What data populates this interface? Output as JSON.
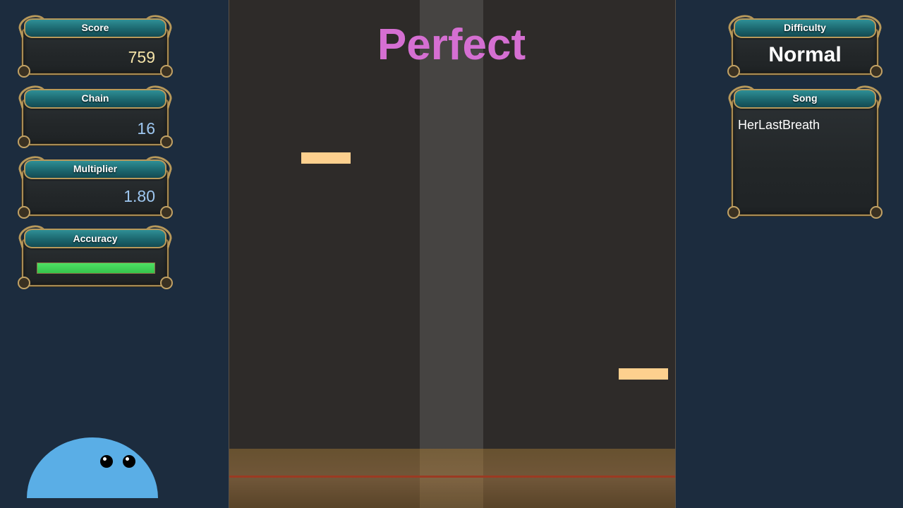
{
  "hud": {
    "score": {
      "label": "Score",
      "value": "759"
    },
    "chain": {
      "label": "Chain",
      "value": "16"
    },
    "multiplier": {
      "label": "Multiplier",
      "value": "1.80"
    },
    "accuracy": {
      "label": "Accuracy",
      "level": 1.0
    },
    "difficulty": {
      "label": "Difficulty",
      "value": "Normal"
    },
    "song": {
      "label": "Song",
      "value": "HerLastBreath"
    }
  },
  "judgement": "Perfect",
  "playfield": {
    "lane_count": 7,
    "highlighted_lane": 4,
    "notes": [
      {
        "lane": 2
      },
      {
        "lane": 7
      }
    ]
  },
  "colors": {
    "background": "#1c2c3e",
    "judgement": "#d56fd2",
    "note": "#fdd08e",
    "score_value": "#f4e3a8",
    "stat_value": "#9ec7f0",
    "accuracy_fill": "#3fd356",
    "mascot": "#5aaee6",
    "hit_line": "#9b3a22"
  },
  "icons": {
    "mascot": "blue-blob-mascot"
  }
}
